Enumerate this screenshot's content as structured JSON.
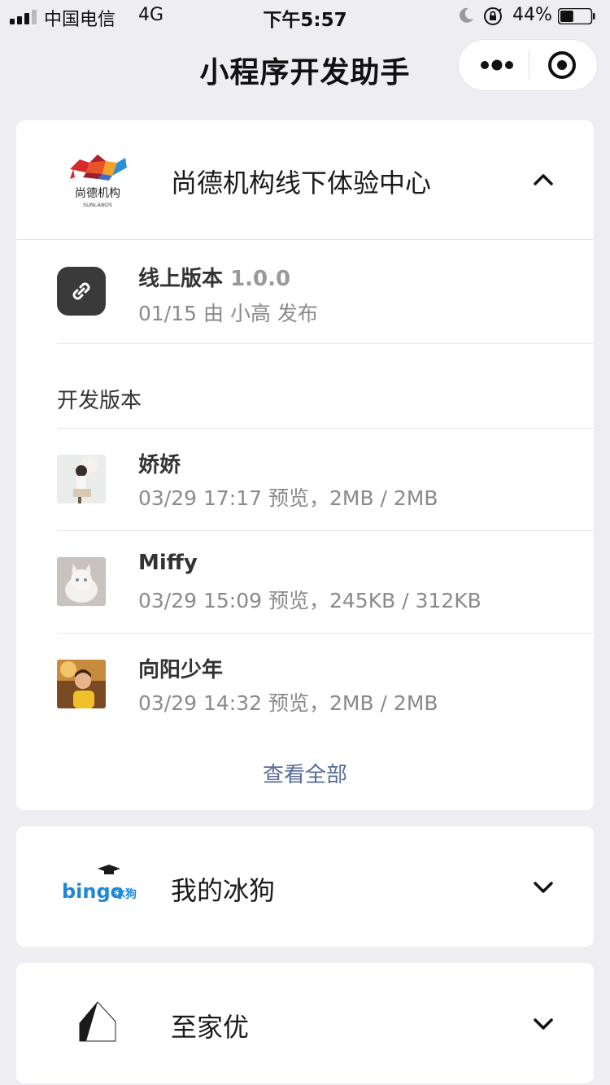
{
  "status_bar": {
    "carrier": "中国电信",
    "network": "4G",
    "time": "下午5:57",
    "battery_percent": "44%",
    "battery_level": 0.44
  },
  "nav": {
    "title": "小程序开发助手",
    "more_icon": "more-dots-icon",
    "close_icon": "target-close-icon"
  },
  "cards": [
    {
      "name": "尚德机构线下体验中心",
      "logo_text": "尚德机构",
      "logo_sub": "SUNLANDS",
      "expanded": true,
      "online": {
        "label": "线上版本",
        "version": "1.0.0",
        "sub": "01/15 由 小高 发布",
        "icon": "link-icon"
      },
      "dev_header": "开发版本",
      "dev_versions": [
        {
          "name": "娇娇",
          "meta": "03/29 17:17 预览，2MB / 2MB"
        },
        {
          "name": "Miffy",
          "meta": "03/29 15:09 预览，245KB / 312KB"
        },
        {
          "name": "向阳少年",
          "meta": "03/29 14:32 预览，2MB / 2MB"
        }
      ],
      "view_all": "查看全部"
    },
    {
      "name": "我的冰狗",
      "logo_text": "bingo",
      "logo_cn": "冰狗",
      "expanded": false
    },
    {
      "name": "至家优",
      "expanded": false
    }
  ],
  "colors": {
    "background": "#EDEDF2",
    "link": "#576B95",
    "secondary_text": "#8A8A8A",
    "bingo_blue": "#1E88D8"
  }
}
